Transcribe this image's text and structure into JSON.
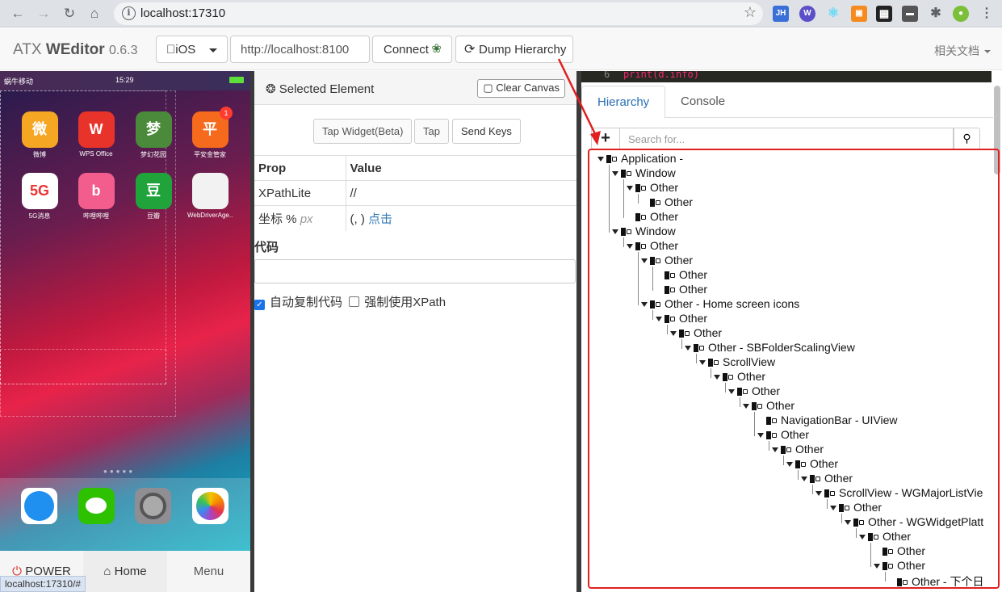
{
  "browser": {
    "url": "localhost:17310",
    "status_link": "localhost:17310/#"
  },
  "app": {
    "brand_prefix": "ATX ",
    "brand_name": "WEditor",
    "version": "0.6.3",
    "platform": "iOS",
    "device_url": "http://localhost:8100",
    "connect_label": "Connect",
    "dump_label": "Dump Hierarchy",
    "docs_label": "相关文档"
  },
  "phone": {
    "carrier": "蜗牛移动",
    "time": "15:29",
    "apps": [
      {
        "label": "微博",
        "glyph": "微",
        "color": "#f5a623"
      },
      {
        "label": "WPS Office",
        "glyph": "W",
        "color": "#e8332b"
      },
      {
        "label": "梦幻花园",
        "glyph": "梦",
        "color": "#4a8a3a"
      },
      {
        "label": "平安金管家",
        "glyph": "平",
        "color": "#f56a1c",
        "badge": "1"
      },
      {
        "label": "5G消息",
        "glyph": "5G",
        "color": "#ffffff"
      },
      {
        "label": "哔哩哔哩",
        "glyph": "b",
        "color": "#f25d8e"
      },
      {
        "label": "豆瓣",
        "glyph": "豆",
        "color": "#1fa33a"
      },
      {
        "label": "WebDriverAge...",
        "glyph": "",
        "color": "#f2f2f2"
      }
    ],
    "buttons": {
      "power": "POWER",
      "home": "Home",
      "menu": "Menu"
    }
  },
  "selected": {
    "title": "Selected Element",
    "clear_canvas": "Clear Canvas",
    "actions": {
      "tap_widget": "Tap Widget(Beta)",
      "tap": "Tap",
      "send_keys": "Send Keys"
    },
    "table": {
      "header_prop": "Prop",
      "header_value": "Value",
      "xpath_label": "XPathLite",
      "xpath_value": "//",
      "coord_label": "坐标 %",
      "coord_unit": "px",
      "coord_value": "(, )",
      "coord_link": "点击"
    },
    "code_label": "代码",
    "auto_copy": "自动复制代码",
    "force_xpath": "强制使用XPath"
  },
  "editor": {
    "line_no": "6",
    "code": "print(d.info)"
  },
  "tabs": {
    "hierarchy": "Hierarchy",
    "console": "Console"
  },
  "search": {
    "placeholder": "Search for..."
  },
  "tree": [
    {
      "label": "Application -",
      "depth": 0,
      "open": true
    },
    {
      "label": "Window",
      "depth": 1,
      "open": true
    },
    {
      "label": "Other",
      "depth": 2,
      "open": true
    },
    {
      "label": "Other",
      "depth": 3,
      "open": false
    },
    {
      "label": "Other",
      "depth": 2,
      "open": false
    },
    {
      "label": "Window",
      "depth": 1,
      "open": true
    },
    {
      "label": "Other",
      "depth": 2,
      "open": true
    },
    {
      "label": "Other",
      "depth": 3,
      "open": true
    },
    {
      "label": "Other",
      "depth": 4,
      "open": false
    },
    {
      "label": "Other",
      "depth": 4,
      "open": false
    },
    {
      "label": "Other - Home screen icons",
      "depth": 3,
      "open": true
    },
    {
      "label": "Other",
      "depth": 4,
      "open": true
    },
    {
      "label": "Other",
      "depth": 5,
      "open": true
    },
    {
      "label": "Other - SBFolderScalingView",
      "depth": 6,
      "open": true
    },
    {
      "label": "ScrollView",
      "depth": 7,
      "open": true
    },
    {
      "label": "Other",
      "depth": 8,
      "open": true
    },
    {
      "label": "Other",
      "depth": 9,
      "open": true
    },
    {
      "label": "Other",
      "depth": 10,
      "open": true
    },
    {
      "label": "NavigationBar - UIView",
      "depth": 11,
      "open": false
    },
    {
      "label": "Other",
      "depth": 11,
      "open": true
    },
    {
      "label": "Other",
      "depth": 12,
      "open": true
    },
    {
      "label": "Other",
      "depth": 13,
      "open": true
    },
    {
      "label": "Other",
      "depth": 14,
      "open": true
    },
    {
      "label": "ScrollView - WGMajorListVie",
      "depth": 15,
      "open": true
    },
    {
      "label": "Other",
      "depth": 16,
      "open": true
    },
    {
      "label": "Other - WGWidgetPlatt",
      "depth": 17,
      "open": true
    },
    {
      "label": "Other",
      "depth": 18,
      "open": true
    },
    {
      "label": "Other",
      "depth": 19,
      "open": false
    },
    {
      "label": "Other",
      "depth": 19,
      "open": true
    },
    {
      "label": "Other - 下个日",
      "depth": 20,
      "open": false
    }
  ]
}
